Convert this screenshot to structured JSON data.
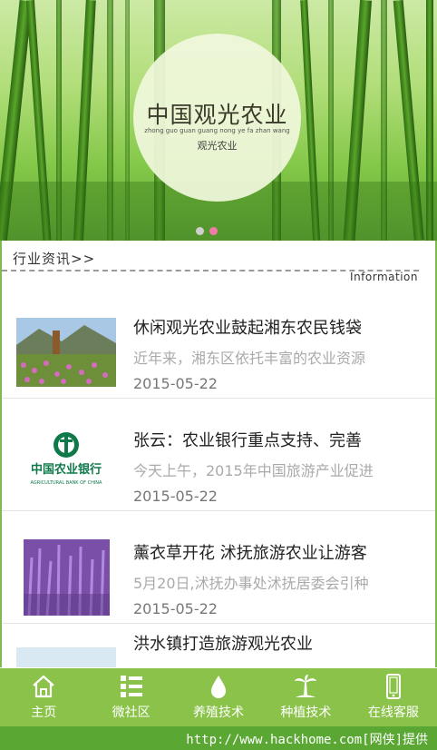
{
  "banner": {
    "title": "中国观光农业",
    "pinyin": "zhong guo guan guang nong ye fa zhan wang",
    "subtitle": "观光农业",
    "active_slide": 2,
    "slide_count": 2
  },
  "section": {
    "title": "行业资讯>>",
    "info": "Information"
  },
  "articles": [
    {
      "title": "休闲观光农业鼓起湘东农民钱袋",
      "summary": "近年来，湘东区依托丰富的农业资源",
      "date": "2015-05-22",
      "thumb": "flower-field-image"
    },
    {
      "title": "张云：农业银行重点支持、完善",
      "summary": "今天上午，2015年中国旅游产业促进",
      "date": "2015-05-22",
      "thumb": "agricultural-bank-logo"
    },
    {
      "title": "薰衣草开花 沭抚旅游农业让游客",
      "summary": "5月20日,沭抚办事处沭抚居委会引种",
      "date": "2015-05-22",
      "thumb": "lavender-field-image"
    },
    {
      "title": "洪水镇打造旅游观光农业",
      "summary": "",
      "date": "",
      "thumb": "landscape-image"
    }
  ],
  "bank_logo": {
    "cn": "中国农业银行",
    "en": "AGRICULTURAL BANK OF CHINA"
  },
  "nav": [
    {
      "label": "主页",
      "icon": "home-icon"
    },
    {
      "label": "微社区",
      "icon": "list-icon"
    },
    {
      "label": "养殖技术",
      "icon": "water-drop-icon"
    },
    {
      "label": "种植技术",
      "icon": "palm-tree-icon"
    },
    {
      "label": "在线客服",
      "icon": "phone-icon"
    }
  ],
  "footer": {
    "text": "http://www.hackhome.com[网侠]提供"
  },
  "colors": {
    "nav_bg": "#8bc34a",
    "footer_bg": "#5aa733",
    "dot_active": "#f17aa8",
    "dot_inactive": "#cfcfcf"
  }
}
